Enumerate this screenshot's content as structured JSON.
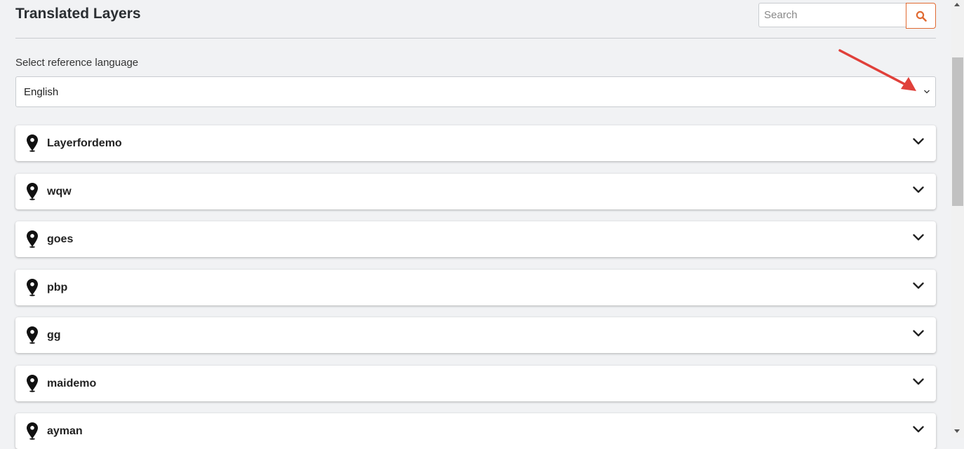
{
  "header": {
    "title": "Translated Layers",
    "search_placeholder": "Search",
    "search_icon": "search-icon",
    "accent_color": "#e06a32"
  },
  "language": {
    "label": "Select reference language",
    "selected": "English"
  },
  "annotation": {
    "arrow_color": "#e0403a"
  },
  "layers": [
    {
      "name": "Layerfordemo",
      "icon": "map-pin-icon"
    },
    {
      "name": "wqw",
      "icon": "map-pin-icon"
    },
    {
      "name": "goes",
      "icon": "map-pin-icon"
    },
    {
      "name": "pbp",
      "icon": "map-pin-icon"
    },
    {
      "name": "gg",
      "icon": "map-pin-icon"
    },
    {
      "name": "maidemo",
      "icon": "map-pin-icon"
    },
    {
      "name": "ayman",
      "icon": "map-pin-icon"
    }
  ]
}
